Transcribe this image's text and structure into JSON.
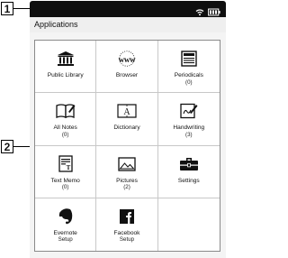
{
  "callouts": {
    "one": "1",
    "two": "2"
  },
  "header": {
    "title": "Applications"
  },
  "status": {
    "icons": [
      "wifi-icon",
      "battery-icon"
    ]
  },
  "apps": [
    {
      "name": "Public Library",
      "sub": "",
      "icon": "library-icon"
    },
    {
      "name": "Browser",
      "sub": "",
      "icon": "www-icon",
      "glyph": "www"
    },
    {
      "name": "Periodicals",
      "sub": "(0)",
      "icon": "periodicals-icon"
    },
    {
      "name": "All Notes",
      "sub": "(0)",
      "icon": "notes-icon"
    },
    {
      "name": "Dictionary",
      "sub": "",
      "icon": "dictionary-icon"
    },
    {
      "name": "Handwriting",
      "sub": "(3)",
      "icon": "handwriting-icon"
    },
    {
      "name": "Text Memo",
      "sub": "(0)",
      "icon": "text-memo-icon"
    },
    {
      "name": "Pictures",
      "sub": "(2)",
      "icon": "pictures-icon"
    },
    {
      "name": "Settings",
      "sub": "",
      "icon": "settings-icon"
    },
    {
      "name": "Evernote",
      "sub": "Setup",
      "icon": "evernote-icon"
    },
    {
      "name": "Facebook",
      "sub": "Setup",
      "icon": "facebook-icon"
    }
  ]
}
